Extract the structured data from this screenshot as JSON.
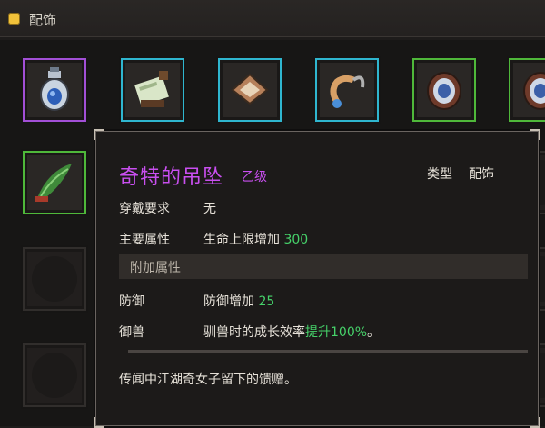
{
  "header": {
    "title": "配饰"
  },
  "slots": [
    {
      "icon": "perfume-bottle-icon",
      "rarity": "purple"
    },
    {
      "icon": "scroll-bundle-icon",
      "rarity": "cyan"
    },
    {
      "icon": "square-talisman-icon",
      "rarity": "cyan"
    },
    {
      "icon": "hook-horn-icon",
      "rarity": "cyan"
    },
    {
      "icon": "patterned-mirror-icon",
      "rarity": "green"
    },
    {
      "icon": "patterned-mirror-icon",
      "rarity": "green"
    },
    {
      "icon": "leaf-bundle-icon",
      "rarity": "green"
    }
  ],
  "tooltip": {
    "name": "奇特的吊坠",
    "grade": "乙级",
    "type_label": "类型",
    "type_value": "配饰",
    "requirement_label": "穿戴要求",
    "requirement_value": "无",
    "main_attr_label": "主要属性",
    "main_attr_text": "生命上限增加",
    "main_attr_num": "300",
    "extra_section": "附加属性",
    "defense_label": "防御",
    "defense_text": "防御增加",
    "defense_num": "25",
    "tame_label": "御兽",
    "tame_text": "驯兽时的成长效率",
    "tame_highlight": "提升100%",
    "tame_end": "。",
    "description": "传闻中江湖奇女子留下的馈赠。"
  },
  "colors": {
    "purple": "#a24fd6",
    "cyan": "#2fb6cf",
    "green": "#4fb83a",
    "name": "#c94ff0",
    "stat_green": "#46d26a"
  }
}
